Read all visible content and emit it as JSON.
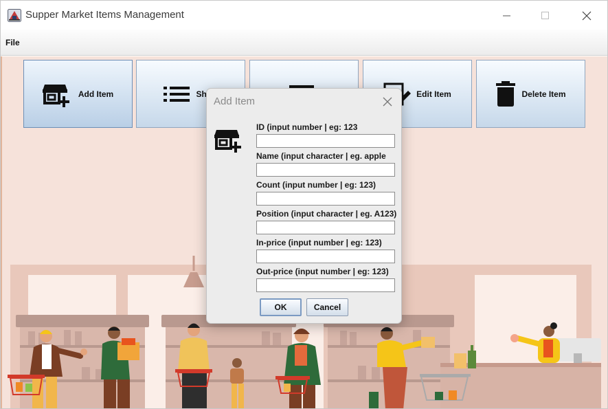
{
  "window": {
    "title": "Supper Market Items Management"
  },
  "menu": {
    "file_label": "File"
  },
  "toolbar": [
    {
      "label": "Add Item",
      "icon": "store-add-icon"
    },
    {
      "label": "Show",
      "icon": "list-icon"
    },
    {
      "label": "",
      "icon": "item-icon"
    },
    {
      "label": "Edit Item",
      "icon": "edit-icon"
    },
    {
      "label": "Delete Item",
      "icon": "trash-icon"
    }
  ],
  "dialog": {
    "title": "Add Item",
    "icon": "store-add-icon",
    "fields": [
      {
        "label": "ID (input number | eg: 123",
        "value": ""
      },
      {
        "label": "Name (input character | eg. apple",
        "value": ""
      },
      {
        "label": "Count (input number | eg: 123)",
        "value": ""
      },
      {
        "label": "Position (input character | eg. A123)",
        "value": ""
      },
      {
        "label": "In-price (input number | eg: 123)",
        "value": ""
      },
      {
        "label": "Out-price (input number | eg: 123)",
        "value": ""
      }
    ],
    "ok_label": "OK",
    "cancel_label": "Cancel"
  },
  "colors": {
    "background": "#f6e2da",
    "toolbar_button": "#c6d8ea",
    "dialog": "#ececec"
  }
}
